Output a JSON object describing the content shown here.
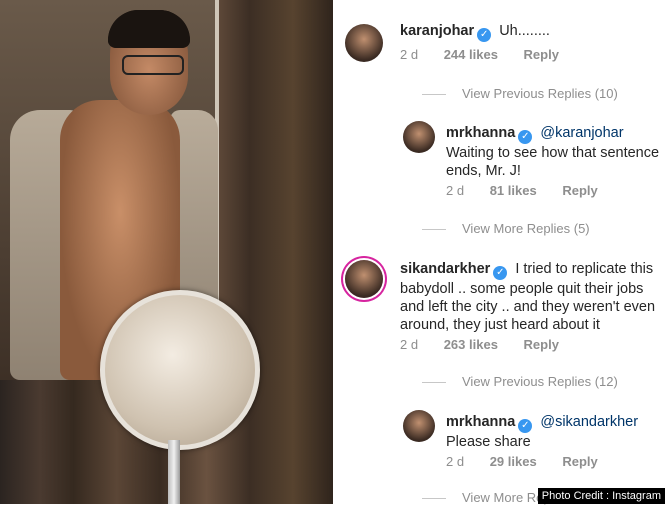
{
  "comments": [
    {
      "user": "karanjohar",
      "text": "Uh........",
      "time": "2 d",
      "likes": "244 likes",
      "reply": "Reply",
      "view_replies": "View Previous Replies (10)"
    },
    {
      "user": "mrkhanna",
      "mention": "@karanjohar",
      "text": "Waiting to see how that sentence ends, Mr. J!",
      "time": "2 d",
      "likes": "81 likes",
      "reply": "Reply",
      "view_replies": "View More Replies (5)"
    },
    {
      "user": "sikandarkher",
      "text": "I tried to replicate this babydoll .. some people quit their jobs and left the city .. and they weren't even around, they just heard about it",
      "time": "2 d",
      "likes": "263 likes",
      "reply": "Reply",
      "view_replies": "View Previous Replies (12)"
    },
    {
      "user": "mrkhanna",
      "mention": "@sikandarkher",
      "text": "Please share",
      "time": "2 d",
      "likes": "29 likes",
      "reply": "Reply",
      "view_replies": "View More Replies"
    }
  ],
  "credit": "Photo Credit : Instagram",
  "verified_color": "#3897f0"
}
